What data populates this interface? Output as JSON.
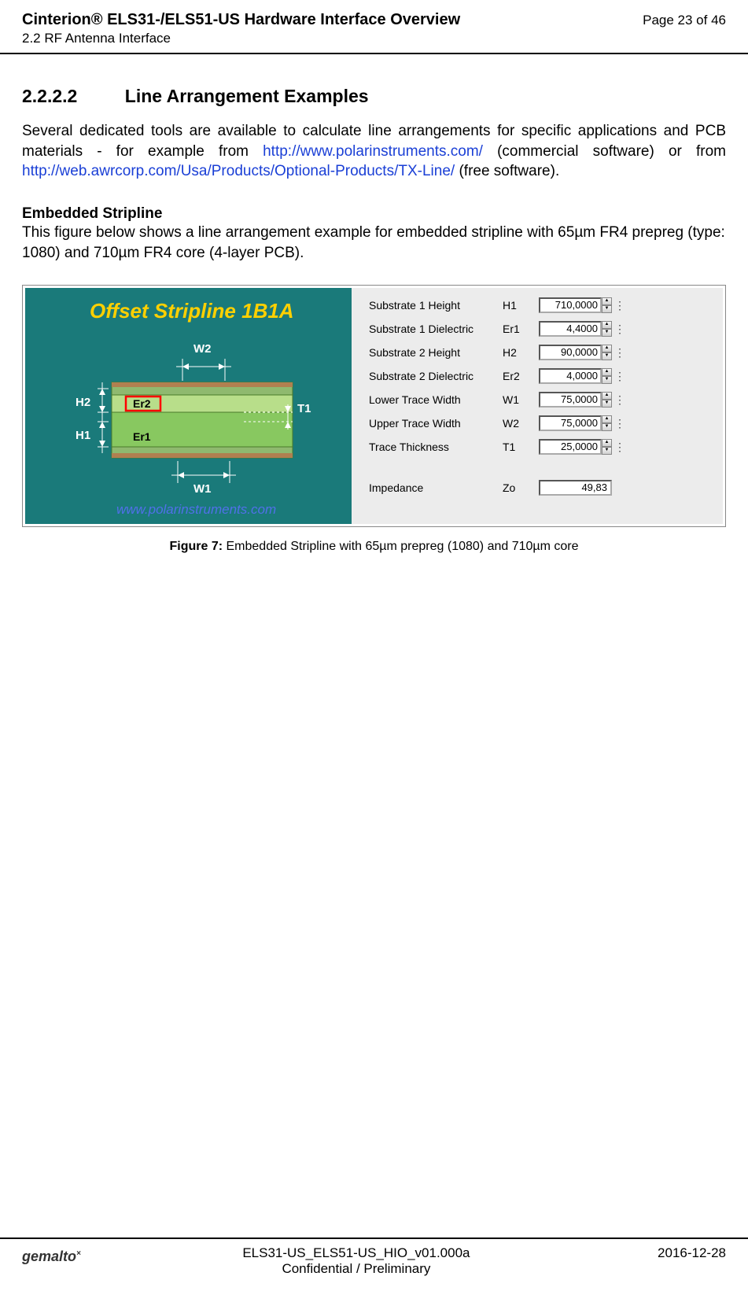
{
  "header": {
    "title": "Cinterion® ELS31-/ELS51-US Hardware Interface Overview",
    "subsection": "2.2 RF Antenna Interface",
    "page": "Page 23 of 46"
  },
  "section": {
    "number": "2.2.2.2",
    "title": "Line Arrangement Examples"
  },
  "para1_a": "Several dedicated tools are available to calculate line arrangements for specific applications and PCB materials - for example from ",
  "para1_link1": "http://www.polarinstruments.com/",
  "para1_b": " (commercial software) or  from ",
  "para1_link2": "http://web.awrcorp.com/Usa/Products/Optional-Products/TX-Line/",
  "para1_c": "  (free software).",
  "subhead": "Embedded Stripline",
  "para2": "This figure below shows a line arrangement example for embedded stripline with 65µm FR4 prepreg (type: 1080) and 710µm FR4 core (4-layer PCB).",
  "figure": {
    "title": "Offset Stripline 1B1A",
    "labels": {
      "W2": "W2",
      "W1": "W1",
      "H1": "H1",
      "H2": "H2",
      "T1": "T1",
      "Er1": "Er1",
      "Er2": "Er2"
    },
    "url": "www.polarinstruments.com",
    "params": [
      {
        "label": "Substrate 1 Height",
        "sym": "H1",
        "value": "710,0000"
      },
      {
        "label": "Substrate 1 Dielectric",
        "sym": "Er1",
        "value": "4,4000"
      },
      {
        "label": "Substrate 2 Height",
        "sym": "H2",
        "value": "90,0000"
      },
      {
        "label": "Substrate 2 Dielectric",
        "sym": "Er2",
        "value": "4,0000"
      },
      {
        "label": "Lower Trace Width",
        "sym": "W1",
        "value": "75,0000"
      },
      {
        "label": "Upper Trace Width",
        "sym": "W2",
        "value": "75,0000"
      },
      {
        "label": "Trace Thickness",
        "sym": "T1",
        "value": "25,0000"
      }
    ],
    "impedance": {
      "label": "Impedance",
      "sym": "Zo",
      "value": "49,83"
    }
  },
  "caption": {
    "prefix": "Figure 7:  ",
    "text": "Embedded Stripline with 65µm prepreg (1080) and 710µm core"
  },
  "footer": {
    "logo": "gemalto",
    "doc": "ELS31-US_ELS51-US_HIO_v01.000a",
    "conf": "Confidential / Preliminary",
    "date": "2016-12-28"
  }
}
